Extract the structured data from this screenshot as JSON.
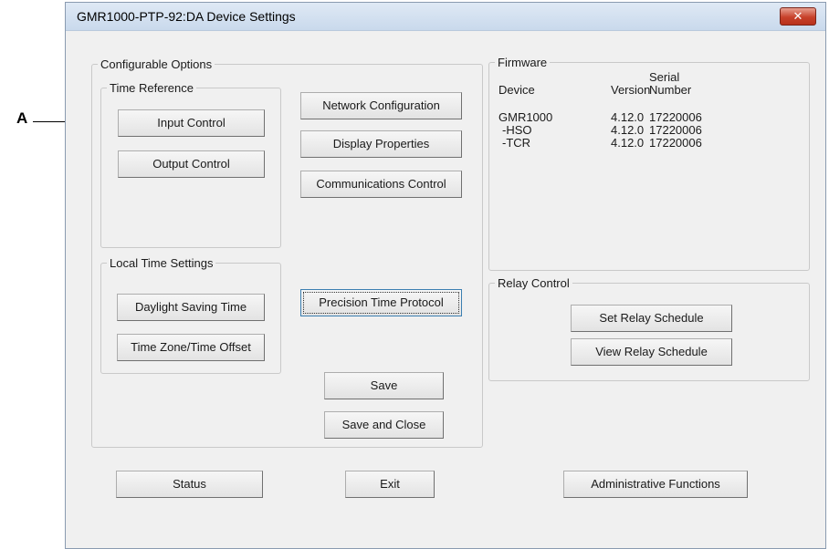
{
  "callout": {
    "letter": "A"
  },
  "window": {
    "title": "GMR1000-PTP-92:DA  Device Settings",
    "close_label": "✕"
  },
  "configurable_options": {
    "legend": "Configurable Options",
    "time_reference": {
      "legend": "Time Reference",
      "input_control": "Input Control",
      "output_control": "Output Control"
    },
    "local_time_settings": {
      "legend": "Local Time Settings",
      "daylight_saving_time": "Daylight Saving Time",
      "time_zone_offset": "Time Zone/Time Offset"
    },
    "network_configuration": "Network Configuration",
    "display_properties": "Display Properties",
    "communications_control": "Communications Control",
    "precision_time_protocol": "Precision Time Protocol",
    "save": "Save",
    "save_and_close": "Save and Close"
  },
  "firmware": {
    "legend": "Firmware",
    "headers": {
      "device": "Device",
      "version": "Version",
      "serial_line1": "Serial",
      "serial_line2": "Number"
    },
    "rows": [
      {
        "device": "GMR1000",
        "version": "4.12.0",
        "serial": "17220006"
      },
      {
        "device": "-HSO",
        "version": "4.12.0",
        "serial": "17220006"
      },
      {
        "device": "-TCR",
        "version": "4.12.0",
        "serial": "17220006"
      }
    ]
  },
  "relay_control": {
    "legend": "Relay Control",
    "set_schedule": "Set Relay Schedule",
    "view_schedule": "View Relay Schedule"
  },
  "footer": {
    "status": "Status",
    "exit": "Exit",
    "administrative_functions": "Administrative Functions"
  }
}
